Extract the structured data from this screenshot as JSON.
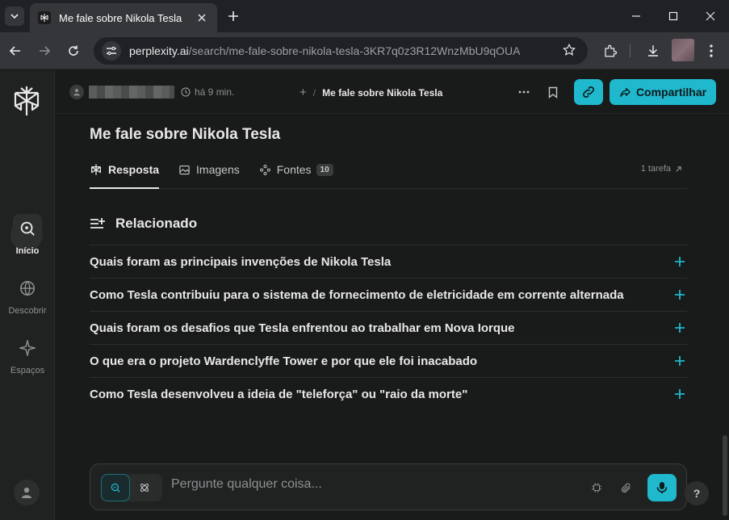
{
  "browser": {
    "tab_title": "Me fale sobre Nikola Tesla",
    "url_host": "perplexity.ai",
    "url_path": "/search/me-fale-sobre-nikola-tesla-3KR7q0z3R12WnzMbU9qOUA"
  },
  "sidebar": {
    "items": [
      {
        "label": "Início",
        "icon": "search-icon"
      },
      {
        "label": "Descobrir",
        "icon": "globe-icon"
      },
      {
        "label": "Espaços",
        "icon": "sparkle-icon"
      }
    ]
  },
  "header": {
    "time_ago": "há 9 min.",
    "separator": "/",
    "thread_title": "Me fale sobre Nikola Tesla",
    "share_label": "Compartilhar"
  },
  "question": {
    "title": "Me fale sobre Nikola Tesla"
  },
  "tabs": [
    {
      "label": "Resposta",
      "active": true
    },
    {
      "label": "Imagens"
    },
    {
      "label": "Fontes",
      "badge": "10"
    }
  ],
  "task_link": "1 tarefa",
  "related": {
    "heading": "Relacionado",
    "items": [
      "Quais foram as principais invenções de Nikola Tesla",
      "Como Tesla contribuiu para o sistema de fornecimento de eletricidade em corrente alternada",
      "Quais foram os desafios que Tesla enfrentou ao trabalhar em Nova Iorque",
      "O que era o projeto Wardenclyffe Tower e por que ele foi inacabado",
      "Como Tesla desenvolveu a ideia de \"teleforça\" ou \"raio da morte\""
    ]
  },
  "ask": {
    "placeholder": "Pergunte qualquer coisa..."
  },
  "help_label": "?",
  "colors": {
    "accent": "#1fb8cd",
    "background": "#191a1a",
    "sidebar": "#202222"
  }
}
